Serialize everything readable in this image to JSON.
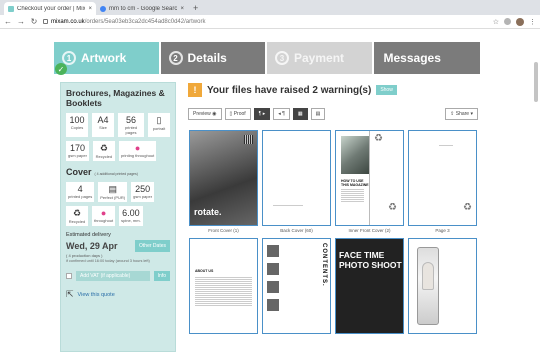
{
  "browser": {
    "tabs": [
      {
        "title": "Checkout your order | Mixam | ",
        "active": true,
        "favicon_color": "#7fcecb"
      },
      {
        "title": "mm to cm - Google Search",
        "active": false,
        "favicon_color": "#4285f4"
      }
    ],
    "new_tab": "+",
    "close": "×",
    "url_host": "mixam.co.uk",
    "url_path": "/orders/5ea03eb3ca2dc454ad8c0d42/artwork",
    "nav": {
      "back": "←",
      "forward": "→",
      "reload": "↻"
    }
  },
  "steps": [
    {
      "num": "1",
      "label": "Artwork"
    },
    {
      "num": "2",
      "label": "Details"
    },
    {
      "num": "3",
      "label": "Payment"
    },
    {
      "num": "",
      "label": "Messages"
    }
  ],
  "check": "✓",
  "sidebar": {
    "title": "Brochures, Magazines & Booklets",
    "specs": [
      {
        "value": "100",
        "label": "Copies"
      },
      {
        "value": "A4",
        "label": "Size"
      },
      {
        "value": "56",
        "label": "printed pages"
      },
      {
        "value": "▯",
        "label": "portrait"
      }
    ],
    "specs2": [
      {
        "value": "170",
        "label": "gsm paper"
      },
      {
        "value": "♻",
        "label": "Recycled"
      },
      {
        "value": "●",
        "label": "printing throughout"
      }
    ],
    "cover_title": "Cover",
    "cover_sub": "( 4 additional printed pages)",
    "cover_specs": [
      {
        "value": "4",
        "label": "printed pages"
      },
      {
        "value": "▤",
        "label": "Perfect (PUR)"
      },
      {
        "value": "250",
        "label": "gsm paper"
      }
    ],
    "cover_specs2": [
      {
        "value": "♻",
        "label": "Recycled"
      },
      {
        "value": "●",
        "label": "throughout"
      },
      {
        "value": "6.00",
        "label": "spine, mm."
      }
    ],
    "delivery_label": "Estimated delivery",
    "delivery_date": "Wed, 29 Apr",
    "other_dates": "Other Dates",
    "production_days": "( 4 production days )",
    "confirm_text": "if confirmed until 16:00 today (around 3 hours left)",
    "vat_label": "Add VAT (if applicable)",
    "vat_info": "Info",
    "quote_icon": "⇱",
    "quote_link": "View this quote"
  },
  "main": {
    "warn_icon": "!",
    "warn_text": "Your files have raised 2 warning(s)",
    "show_label": "Show",
    "toolbar": {
      "preview": "Preview ◉",
      "proof": "▯ Proof",
      "pilcrow1": "¶ ▸",
      "pilcrow2": "◂ ¶",
      "grid": "▦",
      "single": "▤",
      "share": "⇪ Share ▾"
    },
    "captions": [
      "Front Cover (1)",
      "Back Cover (60)",
      "Inner Front Cover (2)",
      "Page 3"
    ],
    "thumb_texts": {
      "rotate": "rotate.",
      "how_to_use": "HOW TO USE THIS MAGAZINE",
      "face": "FACE TIME PHOTO SHOOT",
      "contents": "CONTENTS.",
      "about": "ABOUT US"
    },
    "recycle_icon": "♻"
  }
}
